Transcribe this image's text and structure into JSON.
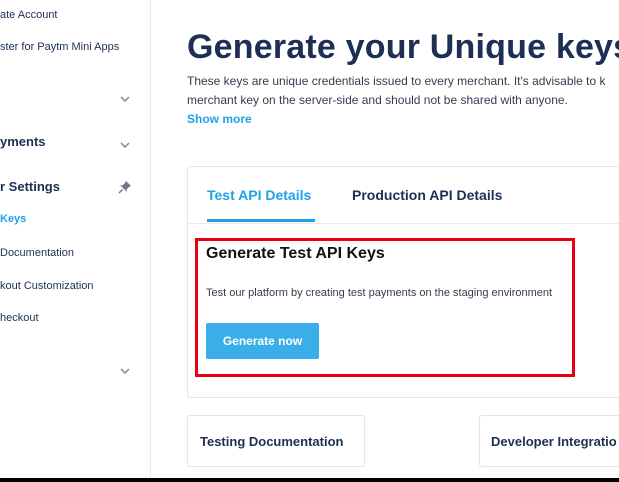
{
  "sidebar": {
    "items": [
      {
        "label": "ate Account"
      },
      {
        "label": "ster for Paytm Mini Apps"
      },
      {
        "label": "yments"
      },
      {
        "label": "r Settings"
      },
      {
        "label": "Keys"
      },
      {
        "label": "Documentation"
      },
      {
        "label": "kout Customization"
      },
      {
        "label": "heckout"
      }
    ]
  },
  "main": {
    "title": "Generate your Unique keys",
    "description_line1": "These keys are unique credentials issued to every merchant. It's advisable to k",
    "description_line2": "merchant key on the server-side and should not be shared with anyone.",
    "show_more": "Show more",
    "tabs": [
      {
        "label": "Test API Details",
        "active": true
      },
      {
        "label": "Production API Details",
        "active": false
      }
    ],
    "section_title": "Generate Test API Keys",
    "section_desc": "Test our platform by creating test payments on the staging environment",
    "generate_button": "Generate now",
    "link_cards": [
      {
        "label": "Testing Documentation"
      },
      {
        "label": "Developer Integratio"
      }
    ]
  },
  "colors": {
    "accent": "#1ea1e8",
    "button": "#3aaee8",
    "highlight_border": "#e60012",
    "text": "#1d2f54"
  },
  "icons": [
    "chevron-down-icon",
    "pin-icon"
  ]
}
